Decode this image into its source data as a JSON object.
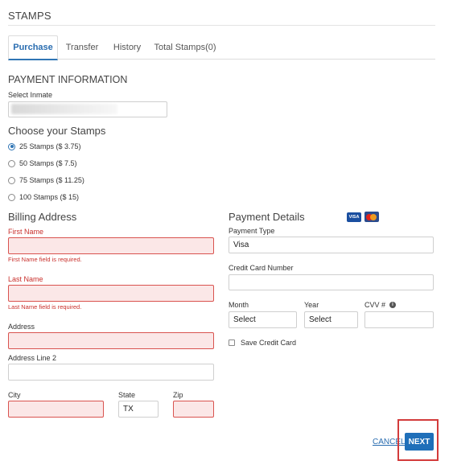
{
  "header": {
    "title": "STAMPS"
  },
  "tabs": [
    {
      "label": "Purchase",
      "active": true
    },
    {
      "label": "Transfer",
      "active": false
    },
    {
      "label": "History",
      "active": false
    },
    {
      "label": "Total Stamps(0)",
      "active": false
    }
  ],
  "payment_info": {
    "title": "PAYMENT INFORMATION",
    "select_inmate_label": "Select Inmate"
  },
  "stamps": {
    "title": "Choose your Stamps",
    "options": [
      {
        "label": "25 Stamps ($ 3.75)",
        "selected": true
      },
      {
        "label": "50 Stamps ($ 7.5)",
        "selected": false
      },
      {
        "label": "75 Stamps ($ 11.25)",
        "selected": false
      },
      {
        "label": "100 Stamps ($ 15)",
        "selected": false
      }
    ]
  },
  "billing": {
    "title": "Billing Address",
    "first_name_label": "First Name",
    "first_name_error": "First Name field is required.",
    "last_name_label": "Last Name",
    "last_name_error": "Last Name field is required.",
    "address_label": "Address",
    "address2_label": "Address Line 2",
    "city_label": "City",
    "state_label": "State",
    "state_value": "TX",
    "zip_label": "Zip"
  },
  "payment": {
    "title": "Payment Details",
    "visa_badge": "VISA",
    "payment_type_label": "Payment Type",
    "payment_type_value": "Visa",
    "card_number_label": "Credit Card Number",
    "month_label": "Month",
    "month_value": "Select",
    "year_label": "Year",
    "year_value": "Select",
    "cvv_label": "CVV #",
    "cvv_info_glyph": "i",
    "save_card_label": "Save Credit Card"
  },
  "actions": {
    "cancel_label": "CANCEL",
    "next_label": "NEXT"
  },
  "colors": {
    "accent": "#1f6fb9",
    "error": "#c9302c",
    "error_bg": "#fbe7e7"
  }
}
